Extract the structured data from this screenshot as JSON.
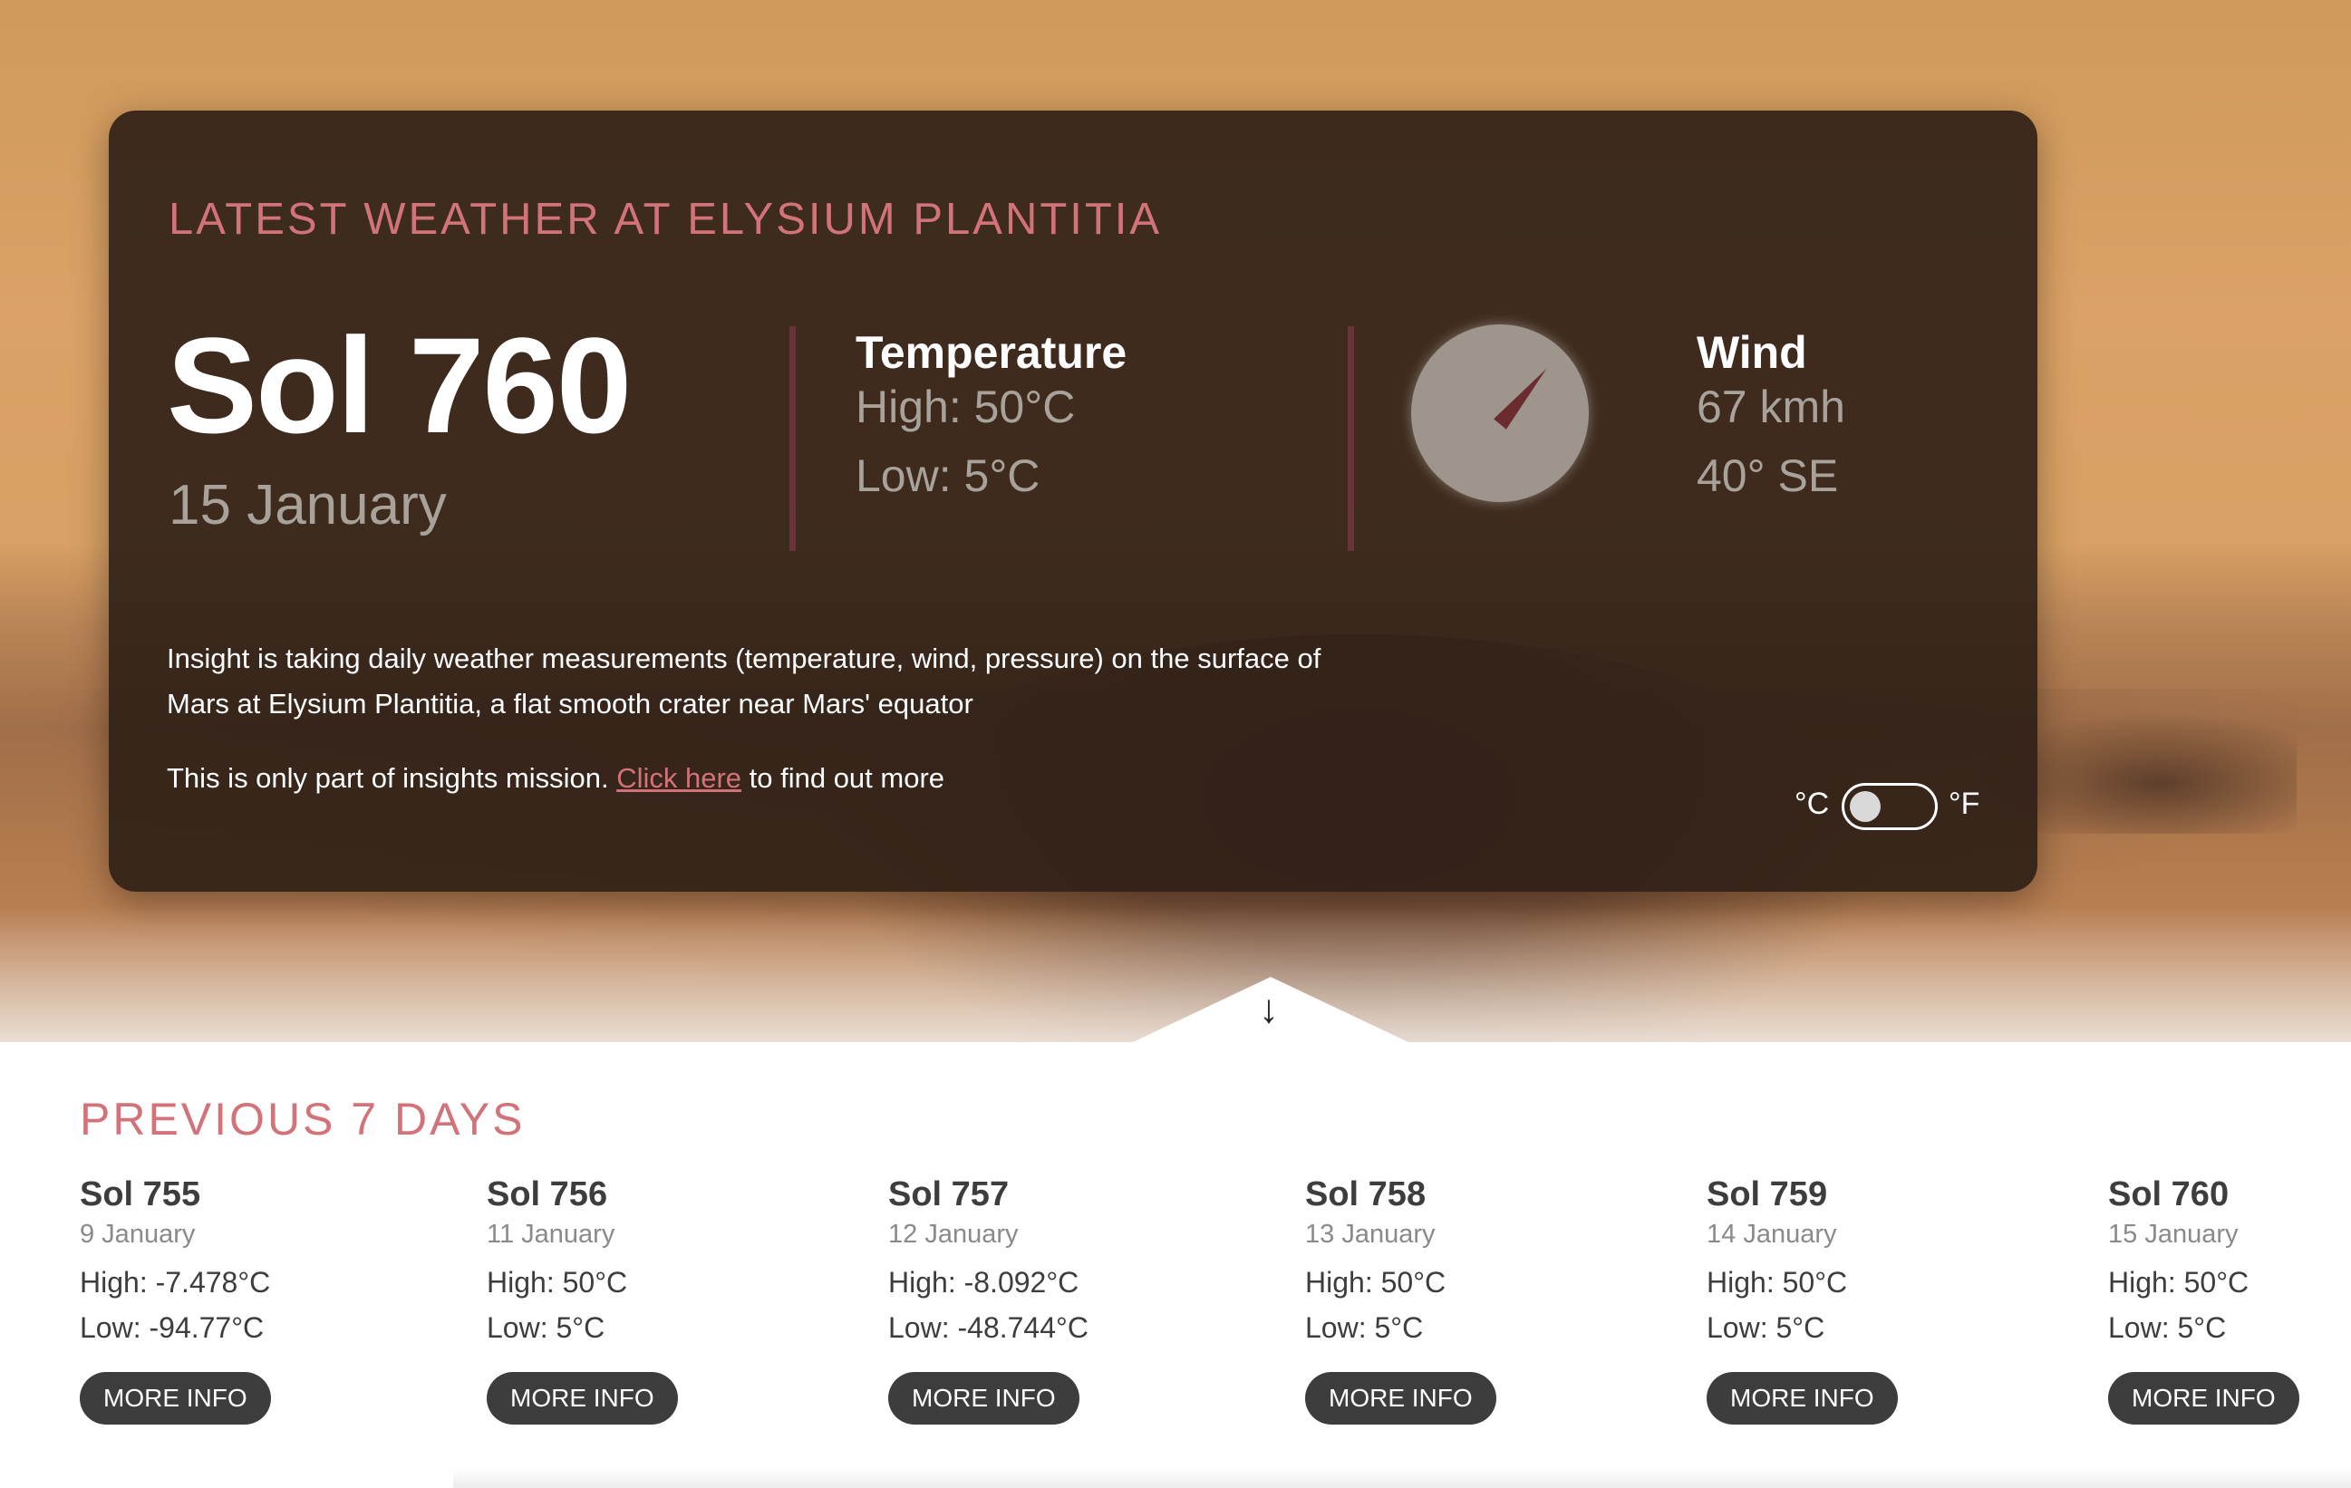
{
  "card": {
    "title": "Latest weather at Elysium Plantitia",
    "sol": "Sol 760",
    "date": "15 January",
    "temperature": {
      "title": "Temperature",
      "high": "High: 50°C",
      "low": "Low: 5°C"
    },
    "wind": {
      "title": "Wind",
      "speed": "67 kmh",
      "direction": "40° SE",
      "degrees": 40
    },
    "description": "Insight is taking daily weather measurements (temperature, wind, pressure) on the surface of Mars at Elysium Plantitia, a flat smooth crater near Mars' equator",
    "mission_prefix": "This is only part of insights mission. ",
    "mission_link": "Click here",
    "mission_suffix": " to find out more",
    "unit_c": "°C",
    "unit_f": "°F",
    "unit_toggle_state": "celsius"
  },
  "previous": {
    "title": "Previous 7 days",
    "button_label": "MORE INFO",
    "days": [
      {
        "sol": "Sol 755",
        "date": "9 January",
        "high": "High: -7.478°C",
        "low": "Low: -94.77°C"
      },
      {
        "sol": "Sol 756",
        "date": "11 January",
        "high": "High: 50°C",
        "low": "Low: 5°C"
      },
      {
        "sol": "Sol 757",
        "date": "12 January",
        "high": "High: -8.092°C",
        "low": "Low: -48.744°C"
      },
      {
        "sol": "Sol 758",
        "date": "13 January",
        "high": "High: 50°C",
        "low": "Low: 5°C"
      },
      {
        "sol": "Sol 759",
        "date": "14 January",
        "high": "High: 50°C",
        "low": "Low: 5°C"
      },
      {
        "sol": "Sol 760",
        "date": "15 January",
        "high": "High: 50°C",
        "low": "Low: 5°C"
      }
    ]
  },
  "colors": {
    "accent": "#d2737a",
    "card_bg": "#2c1e16",
    "button_bg": "#3d3d3d",
    "needle": "#6b2c30"
  },
  "icons": {
    "scroll": "arrow-down-icon",
    "compass": "compass-icon"
  }
}
